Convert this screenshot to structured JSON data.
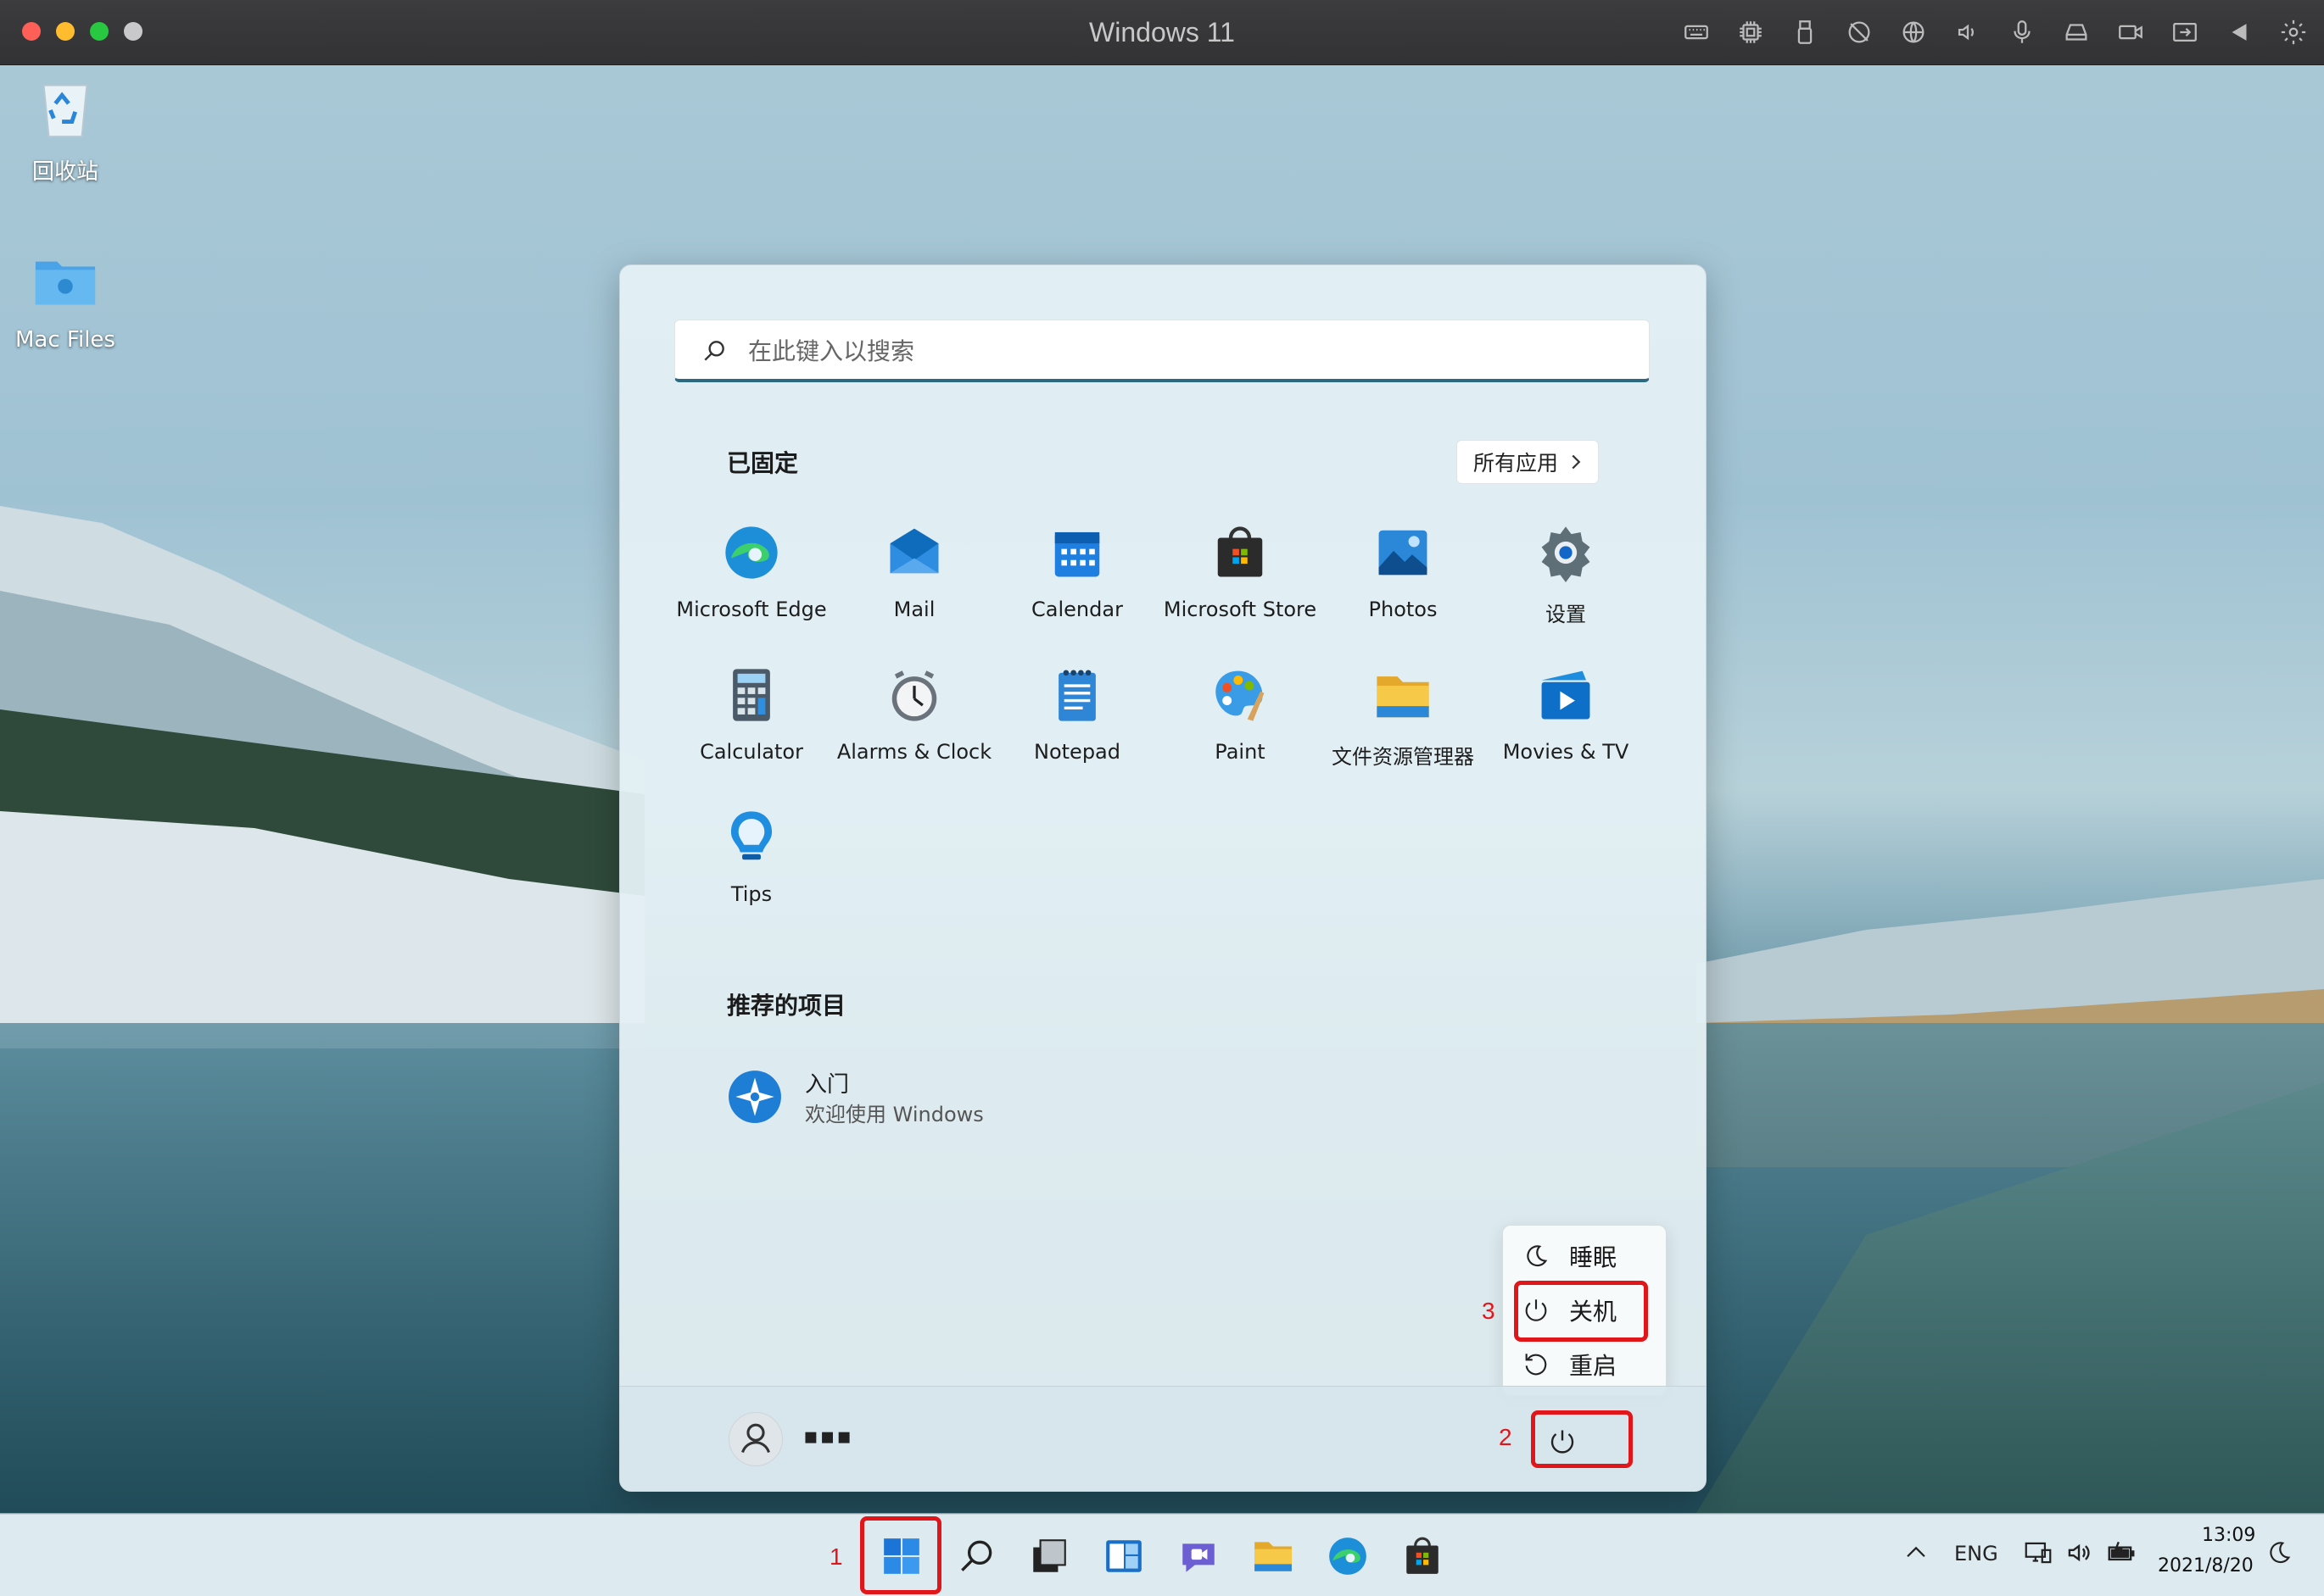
{
  "window": {
    "title": "Windows 11"
  },
  "desktop": {
    "icons": [
      {
        "label": "回收站"
      },
      {
        "label": "Mac Files"
      }
    ]
  },
  "start_menu": {
    "search_placeholder": "在此键入以搜索",
    "pinned_title": "已固定",
    "all_apps_label": "所有应用",
    "pinned_apps": [
      {
        "label": "Microsoft Edge",
        "icon": "edge-icon"
      },
      {
        "label": "Mail",
        "icon": "mail-icon"
      },
      {
        "label": "Calendar",
        "icon": "calendar-icon"
      },
      {
        "label": "Microsoft Store",
        "icon": "store-icon"
      },
      {
        "label": "Photos",
        "icon": "photos-icon"
      },
      {
        "label": "设置",
        "icon": "settings-icon"
      },
      {
        "label": "Calculator",
        "icon": "calculator-icon"
      },
      {
        "label": "Alarms & Clock",
        "icon": "alarm-clock-icon"
      },
      {
        "label": "Notepad",
        "icon": "notepad-icon"
      },
      {
        "label": "Paint",
        "icon": "paint-icon"
      },
      {
        "label": "文件资源管理器",
        "icon": "file-explorer-icon"
      },
      {
        "label": "Movies & TV",
        "icon": "movies-icon"
      },
      {
        "label": "Tips",
        "icon": "tips-icon"
      }
    ],
    "recommended_title": "推荐的项目",
    "recommended": [
      {
        "title": "入门",
        "subtitle": "欢迎使用 Windows"
      }
    ],
    "user_name": "▪▪▪",
    "power_menu": [
      {
        "label": "睡眠",
        "icon": "sleep-icon"
      },
      {
        "label": "关机",
        "icon": "power-icon"
      },
      {
        "label": "重启",
        "icon": "restart-icon"
      }
    ]
  },
  "annotations": {
    "step1": "1",
    "step2": "2",
    "step3": "3",
    "color": "#e0161b"
  },
  "taskbar": {
    "tray": {
      "lang": "ENG",
      "time": "13:09",
      "date": "2021/8/20"
    }
  }
}
